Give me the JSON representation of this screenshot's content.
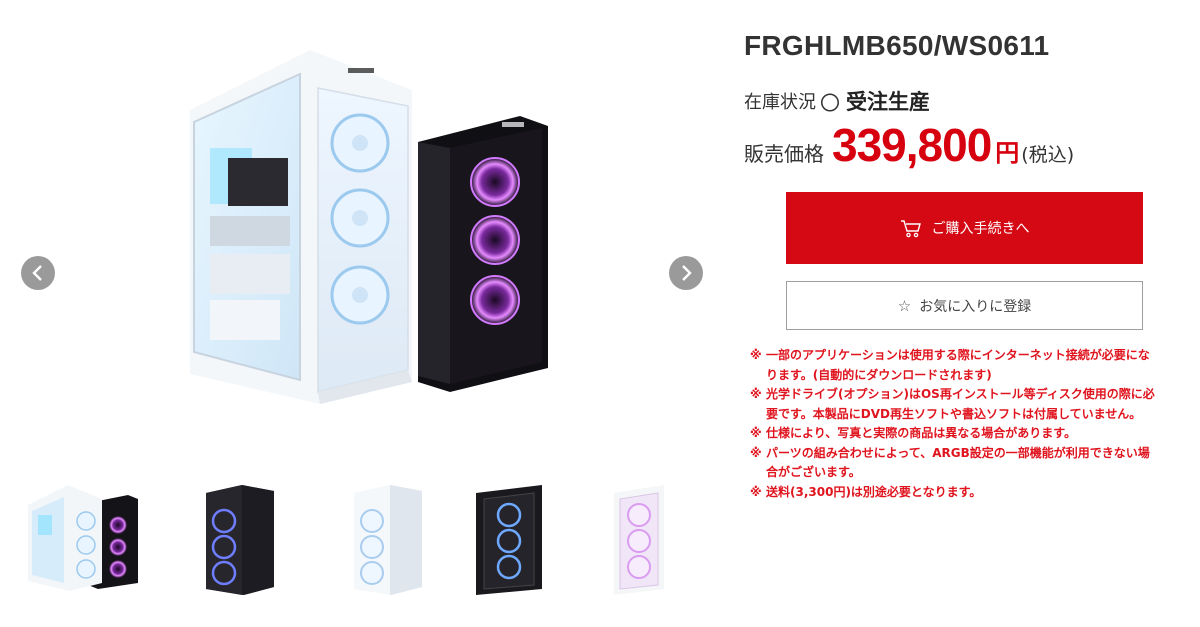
{
  "product": {
    "title": "FRGHLMB650/WS0611",
    "stock_label": "在庫状況",
    "stock_mark": "〇",
    "stock_value": "受注生産",
    "price_label": "販売価格",
    "price_value": "339,800",
    "price_unit": "円",
    "price_tax": "(税込)"
  },
  "actions": {
    "buy_label": "ご購入手続きへ",
    "buy_icon": "cart-icon",
    "favorite_label": "お気に入りに登録",
    "favorite_icon": "star-icon"
  },
  "notes": [
    {
      "mark": "※",
      "text": "一部のアプリケーションは使用する際にインターネット接続が必要になります。(自動的にダウンロードされます)"
    },
    {
      "mark": "※",
      "text": "光学ドライブ(オプション)はOS再インストール等ディスク使用の際に必要です。本製品にDVD再生ソフトや書込ソフトは付属していません。"
    },
    {
      "mark": "※",
      "text": "仕様により、写真と実際の商品は異なる場合があります。"
    },
    {
      "mark": "※",
      "text": "パーツの組み合わせによって、ARGB設定の一部機能が利用できない場合がございます。"
    },
    {
      "mark": "※",
      "text": "送料(3,300円)は別途必要となります。"
    }
  ],
  "gallery": {
    "prev_icon": "chevron-left-icon",
    "next_icon": "chevron-right-icon",
    "thumbnails": [
      "white-and-black-pc-pair",
      "black-pc-front",
      "white-pc-front",
      "black-pc-mesh-front",
      "white-pc-pink-fans"
    ]
  },
  "colors": {
    "accent_red": "#d40914",
    "price_red": "#d7000f",
    "note_red": "#e0141e",
    "fan_blue": "#8fd0ff",
    "fan_purple": "#c65bff"
  }
}
